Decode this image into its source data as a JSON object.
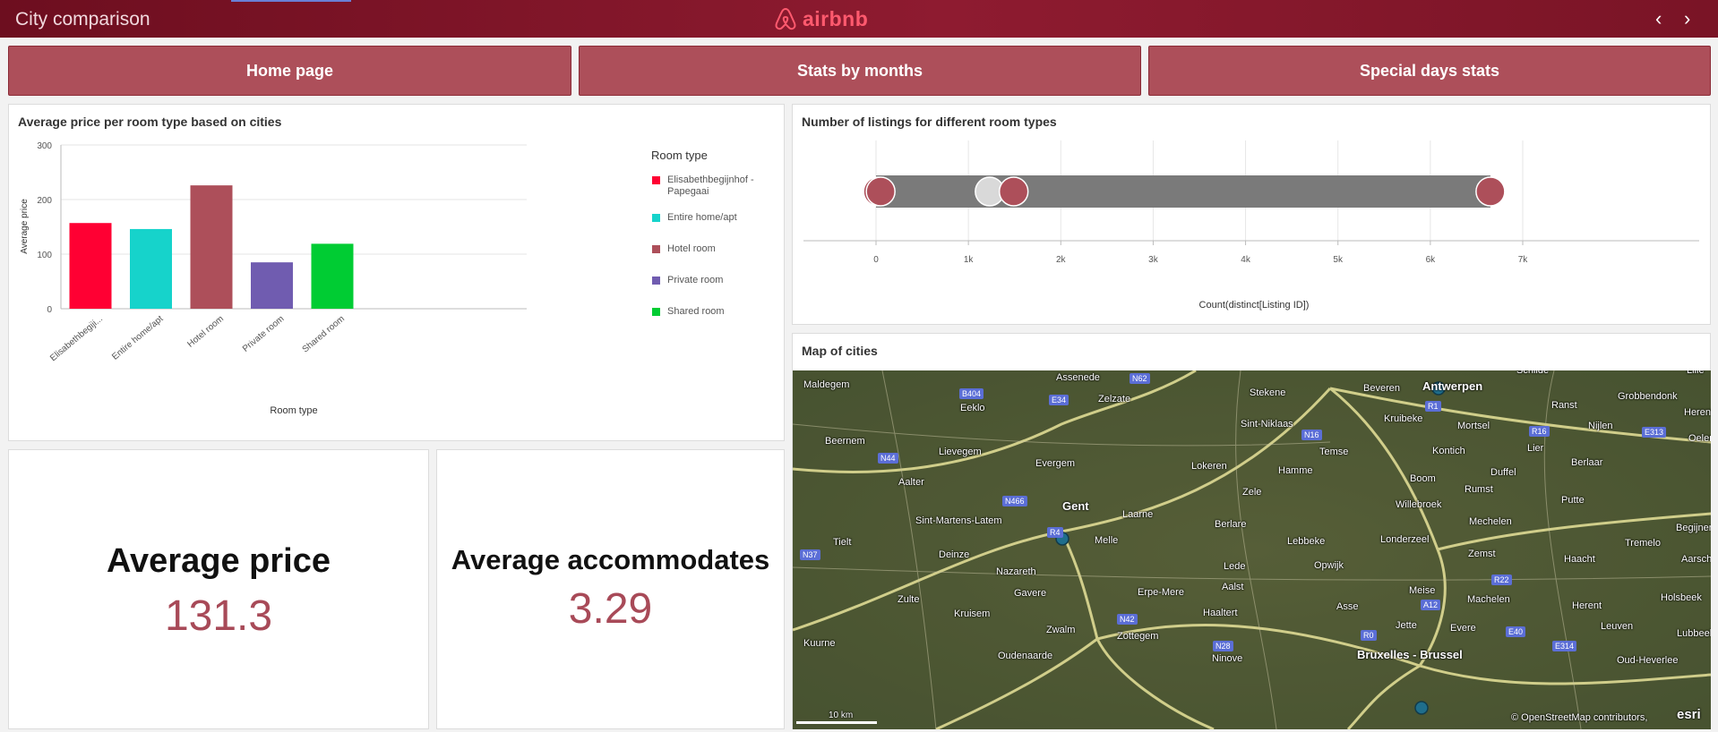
{
  "header": {
    "title": "City comparison",
    "logo_text": "airbnb",
    "prev_label": "‹",
    "next_label": "›"
  },
  "nav": [
    {
      "label": "Home page"
    },
    {
      "label": "Stats by months"
    },
    {
      "label": "Special days stats"
    }
  ],
  "bar_panel": {
    "title": "Average price per room type based on cities",
    "legend_title": "Room type",
    "legend": [
      {
        "label": "Elisabethbegijnhof - Papegaai",
        "color": "#ff0033"
      },
      {
        "label": "Entire home/apt",
        "color": "#16d3cb"
      },
      {
        "label": "Hotel room",
        "color": "#ad4f5a"
      },
      {
        "label": "Private room",
        "color": "#705cb0"
      },
      {
        "label": "Shared room",
        "color": "#00cc33"
      }
    ]
  },
  "listing_panel": {
    "title": "Number of listings for different room types"
  },
  "map_panel": {
    "title": "Map of cities",
    "scale_label": "10 km",
    "attribution": "© OpenStreetMap contributors,",
    "esri": "esri",
    "labels": [
      "Maldegem",
      "Assenede",
      "Stekene",
      "Beveren",
      "Antwerpen",
      "Eeklo",
      "Zelzate",
      "Kruibeke",
      "Ranst",
      "Grobbendonk",
      "Herentals",
      "Beernem",
      "Sint-Niklaas",
      "Mortsel",
      "Nijlen",
      "Lievegem",
      "Temse",
      "Kontich",
      "Lier",
      "Berlaar",
      "Evergem",
      "Lokeren",
      "Hamme",
      "Aalter",
      "Boom",
      "Duffel",
      "Zele",
      "Rumst",
      "Gent",
      "Laarne",
      "Willebroek",
      "Putte",
      "Sint-Martens-Latem",
      "Berlare",
      "Mechelen",
      "Tielt",
      "Melle",
      "Lebbeke",
      "Londerzeel",
      "Zemst",
      "Begijnendijk",
      "Deinze",
      "Opwijk",
      "Haacht",
      "Aarschot",
      "Nazareth",
      "Lede",
      "Tremelo",
      "Gavere",
      "Erpe-Mere",
      "Aalst",
      "Meise",
      "Zulte",
      "Machelen",
      "Herent",
      "Holsbeek",
      "Kruisem",
      "Haaltert",
      "Asse",
      "Zottegem",
      "Jette",
      "Evere",
      "Leuven",
      "Kuurne",
      "Zwalm",
      "Oudenaarde",
      "Ninove",
      "Bruxelles - Brussel",
      "Lubbeek",
      "Oud-Heverlee",
      "Oelen",
      "Schilde",
      "Lille"
    ],
    "roads": [
      "N62",
      "B404",
      "E34",
      "R1",
      "N16",
      "R16",
      "E313",
      "N44",
      "N466",
      "R4",
      "N37",
      "R22",
      "A12",
      "N42",
      "N28",
      "R0",
      "E40",
      "E314"
    ]
  },
  "kpis": [
    {
      "title": "Average price",
      "value": "131.3"
    },
    {
      "title": "Average accommodates",
      "value": "3.29"
    }
  ],
  "chart_data": [
    {
      "type": "bar",
      "title": "Average price per room type based on cities",
      "xlabel": "Room type",
      "ylabel": "Average price",
      "categories": [
        "Elisabethbegiji...",
        "Entire home/apt",
        "Hotel room",
        "Private room",
        "Shared room"
      ],
      "values": [
        157,
        146,
        226,
        85,
        119
      ],
      "colors": [
        "#ff0033",
        "#16d3cb",
        "#ad4f5a",
        "#705cb0",
        "#00cc33"
      ],
      "ylim": [
        0,
        300
      ],
      "yticks": [
        0,
        100,
        200,
        300
      ],
      "grid": true,
      "legend_position": "right"
    },
    {
      "type": "scatter",
      "title": "Number of listings for different room types",
      "xlabel": "Count(distinct[Listing ID])",
      "xlim": [
        0,
        7000
      ],
      "xticks": [
        0,
        1000,
        2000,
        3000,
        4000,
        5000,
        6000,
        7000
      ],
      "xtick_labels": [
        "0",
        "1k",
        "2k",
        "3k",
        "4k",
        "5k",
        "6k",
        "7k"
      ],
      "range": [
        0,
        6650
      ],
      "points": [
        {
          "x": 20,
          "color": "#ad4f5a"
        },
        {
          "x": 50,
          "color": "#ad4f5a"
        },
        {
          "x": 1230,
          "color": "#d9d9d9"
        },
        {
          "x": 1490,
          "color": "#ad4f5a"
        },
        {
          "x": 6650,
          "color": "#ad4f5a"
        }
      ],
      "grid": true
    }
  ]
}
